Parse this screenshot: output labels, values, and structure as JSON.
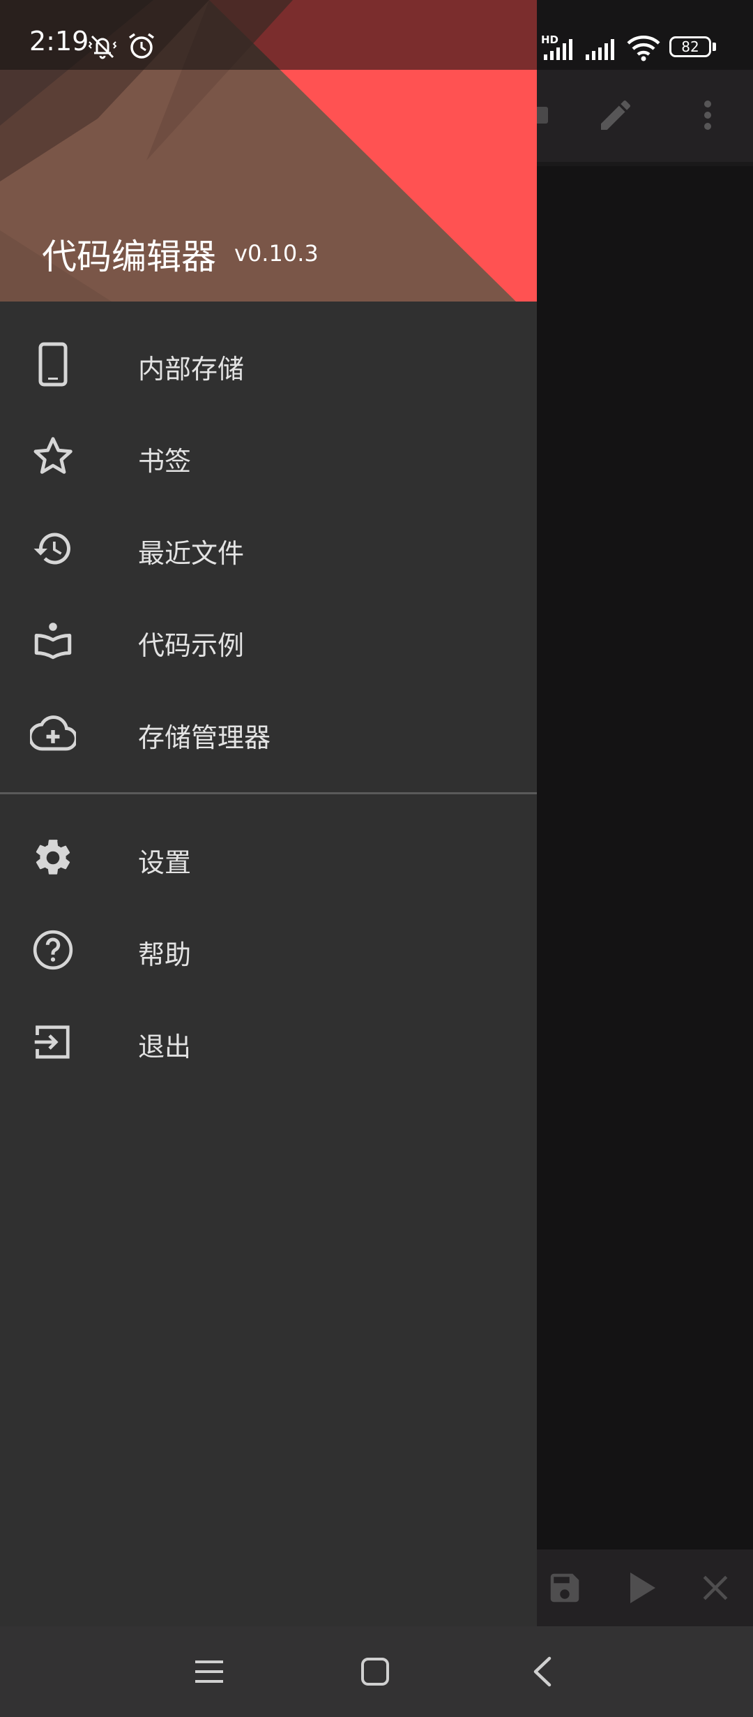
{
  "status_bar": {
    "time": "2:19",
    "network_label": "HD",
    "battery_level": "82"
  },
  "drawer": {
    "app_title": "代码编辑器",
    "version": "v0.10.3",
    "header_colors": {
      "brown": "#7a5648",
      "red": "#ff5252",
      "dark": "#4a3530"
    },
    "primary_items": [
      {
        "label": "内部存储",
        "icon": "phone-icon"
      },
      {
        "label": "书签",
        "icon": "star-icon"
      },
      {
        "label": "最近文件",
        "icon": "history-icon"
      },
      {
        "label": "代码示例",
        "icon": "book-icon"
      },
      {
        "label": "存储管理器",
        "icon": "cloud-add-icon"
      }
    ],
    "secondary_items": [
      {
        "label": "设置",
        "icon": "gear-icon"
      },
      {
        "label": "帮助",
        "icon": "help-icon"
      },
      {
        "label": "退出",
        "icon": "exit-icon"
      }
    ]
  },
  "background_app": {
    "toolbar_icons": [
      "edit-icon",
      "more-icon"
    ],
    "bottom_icons": [
      "save-icon",
      "play-icon",
      "close-icon"
    ]
  },
  "nav_bar": {
    "buttons": [
      "menu",
      "home",
      "back"
    ]
  }
}
